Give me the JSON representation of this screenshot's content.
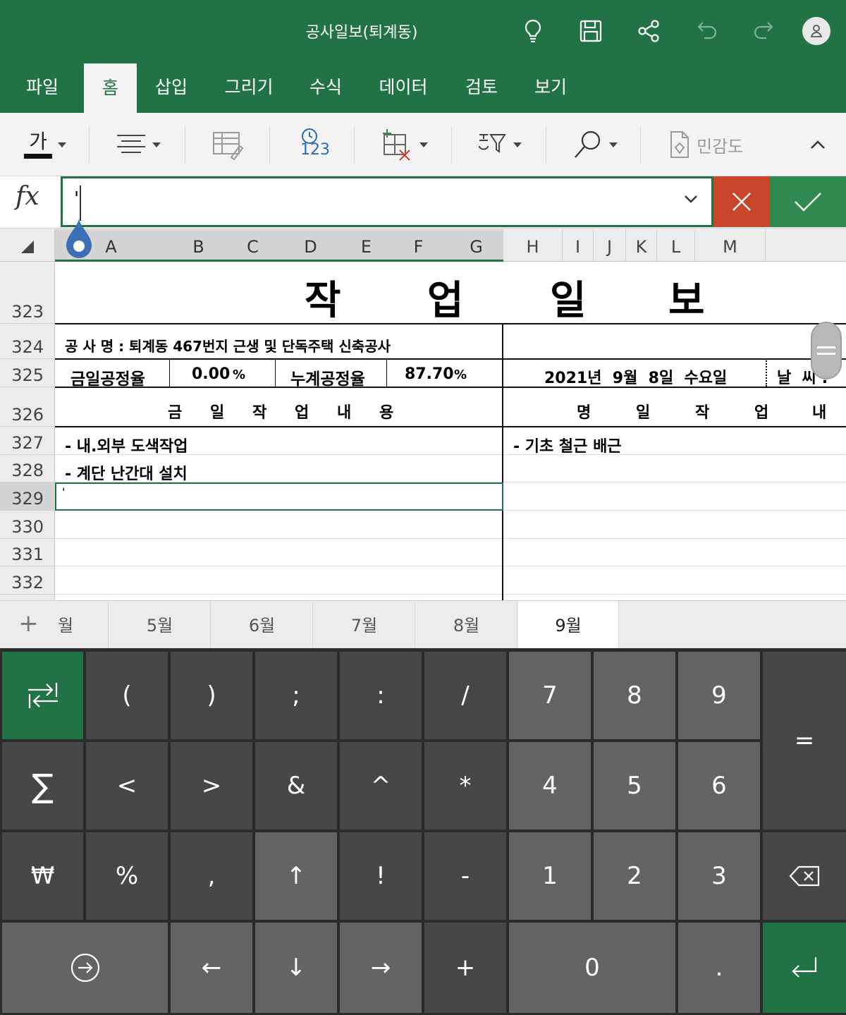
{
  "app": {
    "document_title": "공사일보(퇴계동)",
    "accent_color": "#217346",
    "title_bar_icons": [
      "lightbulb-icon",
      "save-icon",
      "share-icon",
      "undo-icon",
      "redo-icon",
      "account-icon"
    ]
  },
  "ribbon": {
    "tabs": [
      {
        "label": "파일",
        "active": false
      },
      {
        "label": "홈",
        "active": true
      },
      {
        "label": "삽입",
        "active": false
      },
      {
        "label": "그리기",
        "active": false
      },
      {
        "label": "수식",
        "active": false
      },
      {
        "label": "데이터",
        "active": false
      },
      {
        "label": "검토",
        "active": false
      },
      {
        "label": "보기",
        "active": false
      }
    ],
    "tools": {
      "font_glyph": "가",
      "number_format_label": "123",
      "sensitivity_label": "민감도"
    }
  },
  "formula_bar": {
    "fx_label": "fx",
    "value": "'"
  },
  "sheet": {
    "columns": [
      "A",
      "B",
      "C",
      "D",
      "E",
      "F",
      "G",
      "H",
      "I",
      "J",
      "K",
      "L",
      "M"
    ],
    "selected_columns": [
      "A",
      "B",
      "C",
      "D",
      "E",
      "F",
      "G"
    ],
    "rows": [
      "323",
      "324",
      "325",
      "326",
      "327",
      "328",
      "329",
      "330",
      "331",
      "332"
    ],
    "selected_row": "329",
    "title_chars": [
      "작",
      "업",
      "일",
      "보"
    ],
    "project_name": "공 사 명 : 퇴계동 467번지 근생 및 단독주택 신축공사",
    "daily_rate_label": "금일공정율",
    "daily_rate_value": "0.00",
    "daily_rate_unit": "%",
    "cumulative_rate_label": "누계공정율",
    "cumulative_rate_value": "87.70",
    "cumulative_rate_unit": "%",
    "date": "2021년  9월  8일  수요일",
    "weather_label": "날  씨 :",
    "today_work_header": [
      "금",
      "일",
      "작",
      "업",
      "내",
      "용"
    ],
    "tomorrow_work_header": [
      "명",
      "일",
      "작",
      "업",
      "내"
    ],
    "today_work_items": [
      "- 내.외부 도색작업",
      "- 계단 난간대 설치"
    ],
    "tomorrow_work_items": [
      "- 기초 철근 배근"
    ],
    "active_cell_value": "'"
  },
  "sheet_tabs": {
    "add_label": "+",
    "tabs": [
      "월",
      "5월",
      "6월",
      "7월",
      "8월",
      "9월"
    ],
    "active": "9월"
  },
  "keypad": {
    "row1": [
      "(",
      ")",
      ";",
      ":",
      "/",
      "7",
      "8",
      "9"
    ],
    "row2": [
      "<",
      ">",
      "&",
      "^",
      "*",
      "4",
      "5",
      "6"
    ],
    "row3": [
      "₩",
      "%",
      ",",
      "↑",
      "!",
      "-",
      "1",
      "2",
      "3"
    ],
    "row4": [
      "←",
      "↓",
      "→",
      "+",
      "0",
      "."
    ],
    "equals": "="
  }
}
